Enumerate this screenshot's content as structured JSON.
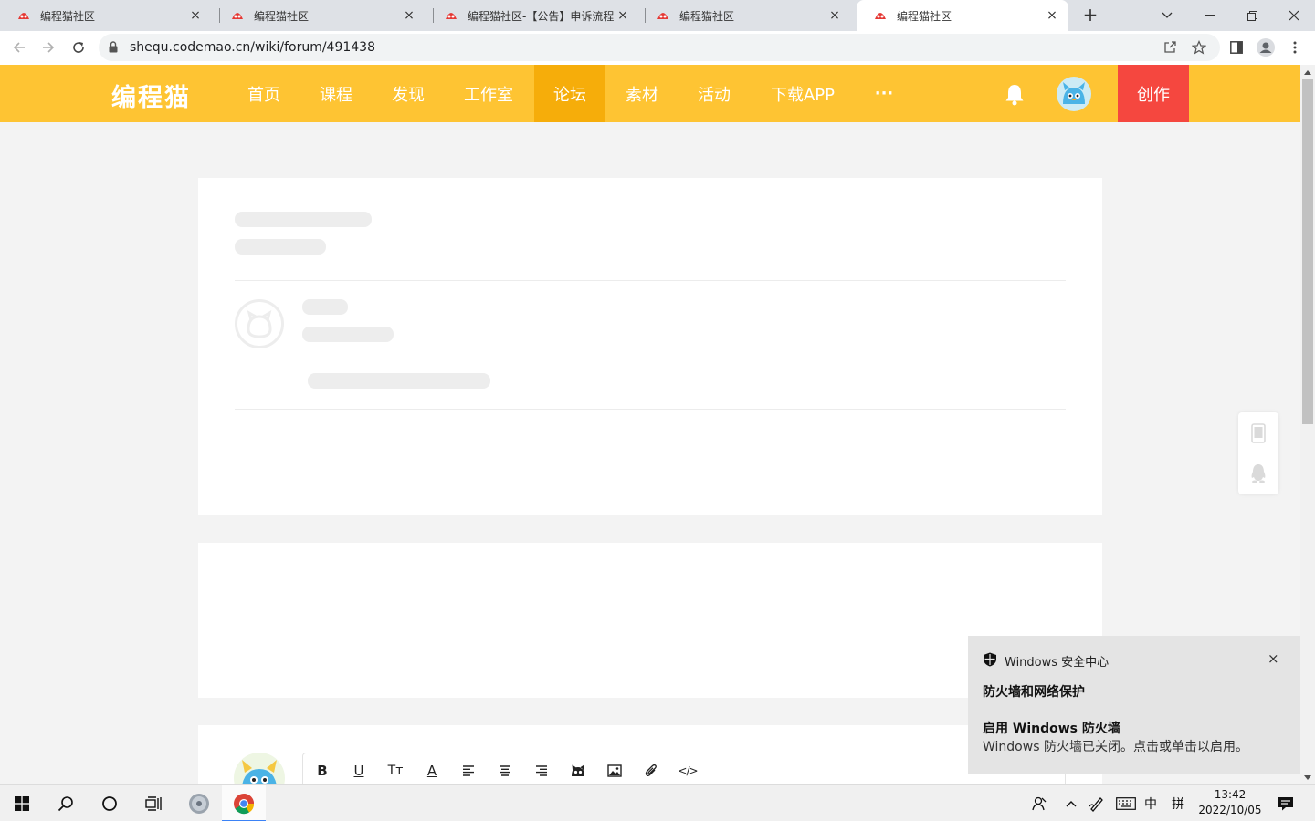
{
  "browser": {
    "tabs": [
      {
        "title": "编程猫社区",
        "active": false
      },
      {
        "title": "编程猫社区",
        "active": false
      },
      {
        "title": "编程猫社区-【公告】申诉流程",
        "active": false
      },
      {
        "title": "编程猫社区",
        "active": false
      },
      {
        "title": "编程猫社区",
        "active": true
      }
    ],
    "tab_close_glyph": "×",
    "new_tab_glyph": "+",
    "url": "shequ.codemao.cn/wiki/forum/491438"
  },
  "site": {
    "logo": "编程猫",
    "nav": [
      {
        "label": "首页",
        "active": false
      },
      {
        "label": "课程",
        "active": false
      },
      {
        "label": "发现",
        "active": false
      },
      {
        "label": "工作室",
        "active": false
      },
      {
        "label": "论坛",
        "active": true
      },
      {
        "label": "素材",
        "active": false
      },
      {
        "label": "活动",
        "active": false
      },
      {
        "label": "下载APP",
        "active": false
      },
      {
        "label": "···",
        "active": false
      }
    ],
    "create_label": "创作",
    "colors": {
      "header": "#fec433",
      "active_nav": "#f6ad0a",
      "create": "#f5473f"
    }
  },
  "editor": {
    "tools": [
      "bold-icon",
      "underline-icon",
      "text-size-icon",
      "text-color-icon",
      "align-left-icon",
      "align-center-icon",
      "align-right-icon",
      "emoji-icon",
      "image-icon",
      "attachment-icon",
      "code-icon"
    ],
    "bold_glyph": "B",
    "underline_glyph": "U",
    "textsize_glyph": "Tт",
    "textcolor_glyph": "A",
    "code_glyph": "</>"
  },
  "toast": {
    "app": "Windows 安全中心",
    "title": "防火墙和网络保护",
    "subtitle": "启用 Windows 防火墙",
    "body": "Windows 防火墙已关闭。点击或单击以启用。",
    "close_glyph": "×"
  },
  "taskbar": {
    "ime_lang": "中",
    "ime_mode": "拼",
    "time": "13:42",
    "date": "2022/10/05"
  }
}
